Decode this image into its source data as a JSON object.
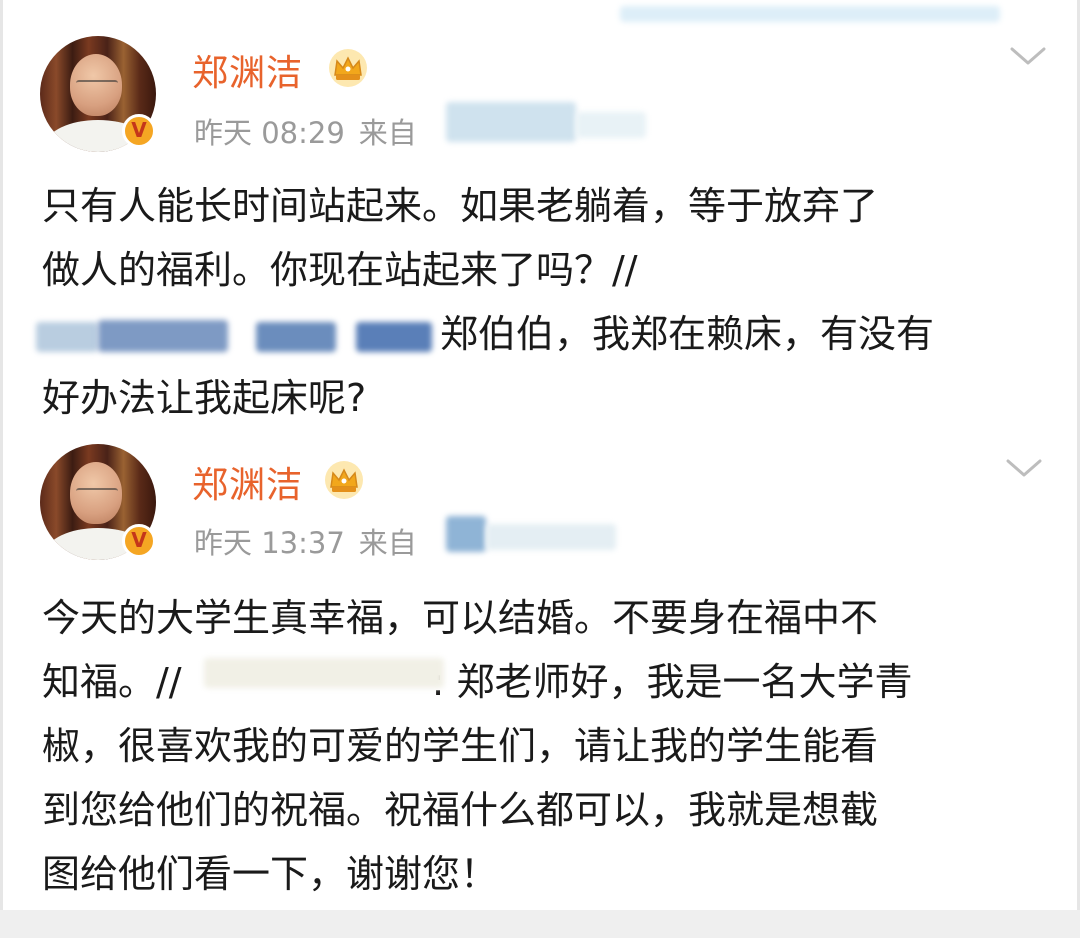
{
  "posts": [
    {
      "username": "郑渊洁",
      "time": "昨天 08:29",
      "source_prefix": "来自",
      "content_lines": [
        "只有人能长时间站起来。如果老躺着，等于放弃了",
        "做人的福利。你现在站起来了吗？//",
        "郑伯伯，我郑在赖床，有没有",
        "好办法让我起床呢?"
      ]
    },
    {
      "username": "郑渊洁",
      "time": "昨天 13:37",
      "source_prefix": "来自",
      "content_lines": [
        "今天的大学生真幸福，可以结婚。不要身在福中不",
        "知福。//",
        ": 郑老师好，我是一名大学青",
        "椒，很喜欢我的可爱的学生们，请让我的学生能看",
        "到您给他们的祝福。祝福什么都可以，我就是想截",
        "图给他们看一下，谢谢您！"
      ]
    }
  ],
  "icons": {
    "vip": "crown-icon",
    "verified": "verified-v-icon",
    "menu": "chevron-down-icon"
  },
  "colors": {
    "username": "#e8632c",
    "meta": "#9a9a9a",
    "badge": "#f5a623",
    "crown": "#f2a71b"
  }
}
